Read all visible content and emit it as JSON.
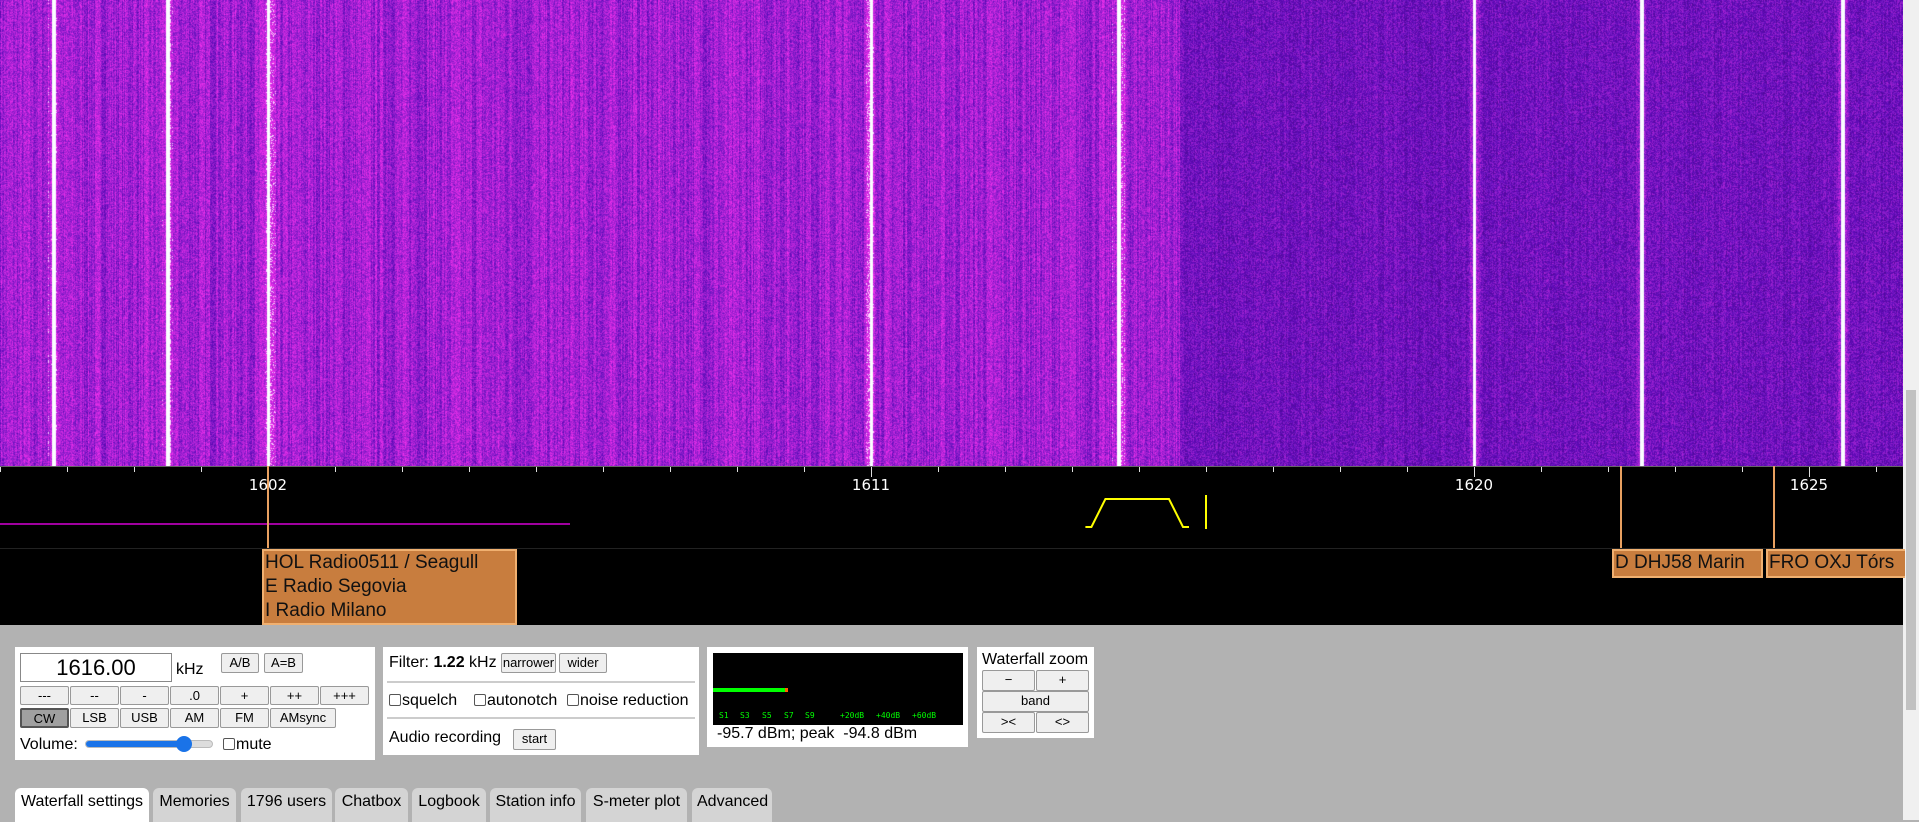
{
  "waterfall": {
    "signals_khz": [
      1598.8,
      1600.5,
      1602,
      1611,
      1614.7,
      1620,
      1622.5,
      1625.5
    ],
    "scale_start_khz": 1598
  },
  "scale": {
    "labels": [
      "1602",
      "1611",
      "1620",
      "1625"
    ],
    "label_khz": [
      1602,
      1611,
      1620,
      1625
    ],
    "tuned_khz": 1616,
    "filter_low_khz": 1614.2,
    "filter_high_khz": 1616
  },
  "stations": [
    {
      "lines": [
        "HOL Radio0511 / Seagull",
        "E Radio Segovia",
        "I Radio Milano"
      ]
    },
    {
      "lines": [
        "D DHJ58 Marin"
      ]
    },
    {
      "lines": [
        "FRO OXJ Tórs"
      ]
    }
  ],
  "freq": {
    "value": "1616.00",
    "unit": "kHz",
    "ab": "A/B",
    "aeqb": "A=B",
    "steps": [
      "---",
      "--",
      "-",
      ".0",
      "+",
      "++",
      "+++"
    ],
    "modes": [
      "CW",
      "LSB",
      "USB",
      "AM",
      "FM",
      "AMsync"
    ],
    "selected_mode": "CW",
    "volume_label": "Volume:",
    "volume_level": 0.78,
    "mute_label": "mute"
  },
  "filter": {
    "label": "Filter:",
    "value": "1.22",
    "unit": "kHz",
    "narrower": "narrower",
    "wider": "wider",
    "squelch": "squelch",
    "autonotch": "autonotch",
    "noise_reduction": "noise reduction",
    "recording_label": "Audio recording",
    "start": "start"
  },
  "smeter": {
    "scale": [
      "S1",
      "S3",
      "S5",
      "S7",
      "S9",
      "+20dB",
      "+40dB",
      "+60dB"
    ],
    "reading": "-95.7 dBm; peak  -94.8 dBm",
    "level_fraction": 0.3,
    "bar_color": "#00ff00"
  },
  "zoom": {
    "title": "Waterfall zoom",
    "minus": "−",
    "plus": "+",
    "band": "band",
    "in": "><",
    "out": "<>"
  },
  "tabs": [
    "Waterfall settings",
    "Memories",
    "1796 users",
    "Chatbox",
    "Logbook",
    "Station info",
    "S-meter plot",
    "Advanced"
  ]
}
